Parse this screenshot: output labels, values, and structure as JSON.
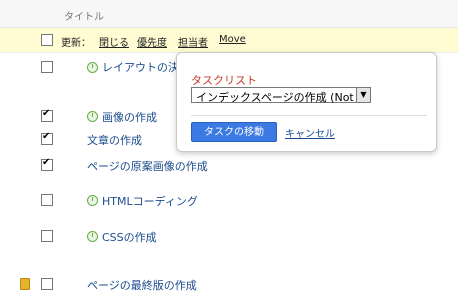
{
  "header": {
    "title": "タイトル"
  },
  "toolbar": {
    "label": "更新：",
    "actions": [
      "閉じる",
      "優先度",
      "担当者",
      "Move"
    ]
  },
  "rows": [
    {
      "title": "レイアウトの決",
      "checked": false,
      "icon": "clock-icon"
    },
    {
      "title": "画像の作成",
      "checked": true,
      "icon": "clock-icon"
    },
    {
      "title": "文章の作成",
      "checked": true,
      "icon": null
    },
    {
      "title": "ページの原案画像の作成",
      "checked": true,
      "icon": null
    },
    {
      "title": "HTMLコーディング",
      "checked": false,
      "icon": "clock-icon"
    },
    {
      "title": "CSSの作成",
      "checked": false,
      "icon": "clock-icon"
    },
    {
      "title": "ページの最終版の作成",
      "checked": false,
      "icon": "note-icon"
    }
  ],
  "popup": {
    "label": "タスクリスト",
    "select_value": "インデックスページの作成 (Not",
    "move_button": "タスクの移動",
    "cancel": "キャンセル"
  }
}
